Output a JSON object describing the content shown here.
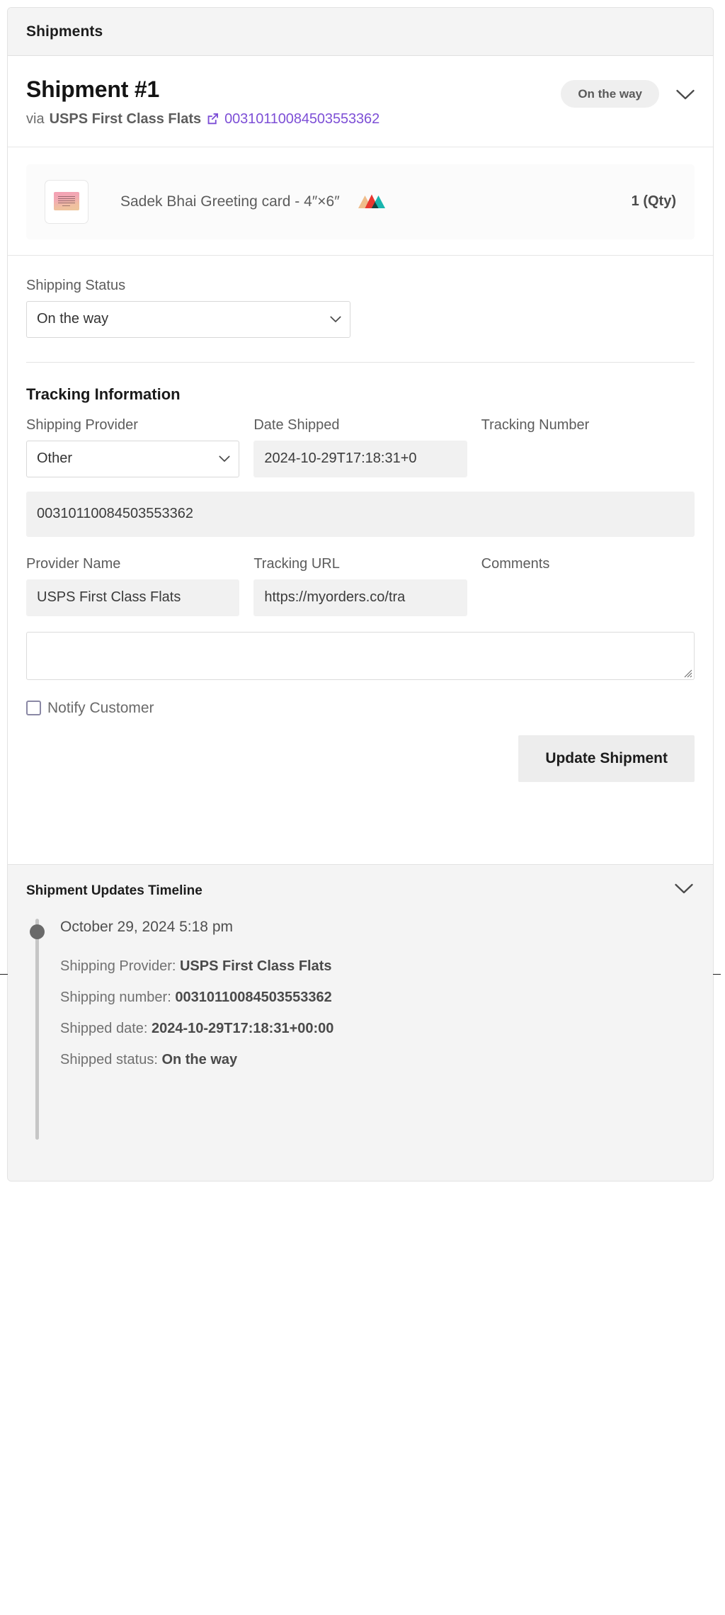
{
  "card": {
    "header_title": "Shipments"
  },
  "shipment": {
    "title": "Shipment #1",
    "via_word": "via",
    "provider": "USPS First Class Flats",
    "external_link_icon": "external-link-icon",
    "tracking_link": "00310110084503553362",
    "status_pill": "On the way",
    "collapse_icon": "chevron-down-icon"
  },
  "product": {
    "thumbnail_icon": "greeting-card-thumbnail",
    "name": "Sadek Bhai Greeting card - 4″×6″",
    "brand_icon": "mountains-icon",
    "qty": "1 (Qty)"
  },
  "shipping_status": {
    "label": "Shipping Status",
    "value": "On the way",
    "dropdown_icon": "chevron-down-icon",
    "options": [
      "On the way"
    ]
  },
  "tracking": {
    "section_title": "Tracking Information",
    "provider_label": "Shipping Provider",
    "provider_value": "Other",
    "provider_dropdown_icon": "chevron-down-icon",
    "provider_options": [
      "Other"
    ],
    "date_shipped_label": "Date Shipped",
    "date_shipped_value": "2024-10-29T17:18:31+0",
    "tracking_number_label": "Tracking Number",
    "tracking_number_value": "00310110084503553362",
    "provider_name_label": "Provider Name",
    "provider_name_value": "USPS First Class Flats",
    "tracking_url_label": "Tracking URL",
    "tracking_url_value": "https://myorders.co/tra",
    "comments_label": "Comments",
    "comments_value": "",
    "resize_grip_icon": "resize-handle-icon"
  },
  "actions": {
    "notify_label": "Notify Customer",
    "notify_checked": false,
    "update_button": "Update Shipment"
  },
  "timeline": {
    "header": "Shipment Updates Timeline",
    "collapse_icon": "chevron-down-icon",
    "entries": [
      {
        "time": "October 29, 2024 5:18 pm",
        "lines": [
          {
            "label": "Shipping Provider: ",
            "value": "USPS First Class Flats"
          },
          {
            "label": "Shipping number: ",
            "value": "00310110084503553362"
          },
          {
            "label": "Shipped date: ",
            "value": "2024-10-29T17:18:31+00:00"
          },
          {
            "label": "Shipped status: ",
            "value": "On the way"
          }
        ]
      }
    ]
  },
  "colors": {
    "link_purple": "#7d4fd6",
    "panel_grey": "#f4f4f4",
    "input_grey": "#f1f1f1",
    "checkbox_border": "#8a88a5",
    "mountain_tan": "#efbd8b",
    "mountain_red": "#e8372f",
    "mountain_teal": "#19b5ae",
    "mountain_dark": "#13443f"
  }
}
